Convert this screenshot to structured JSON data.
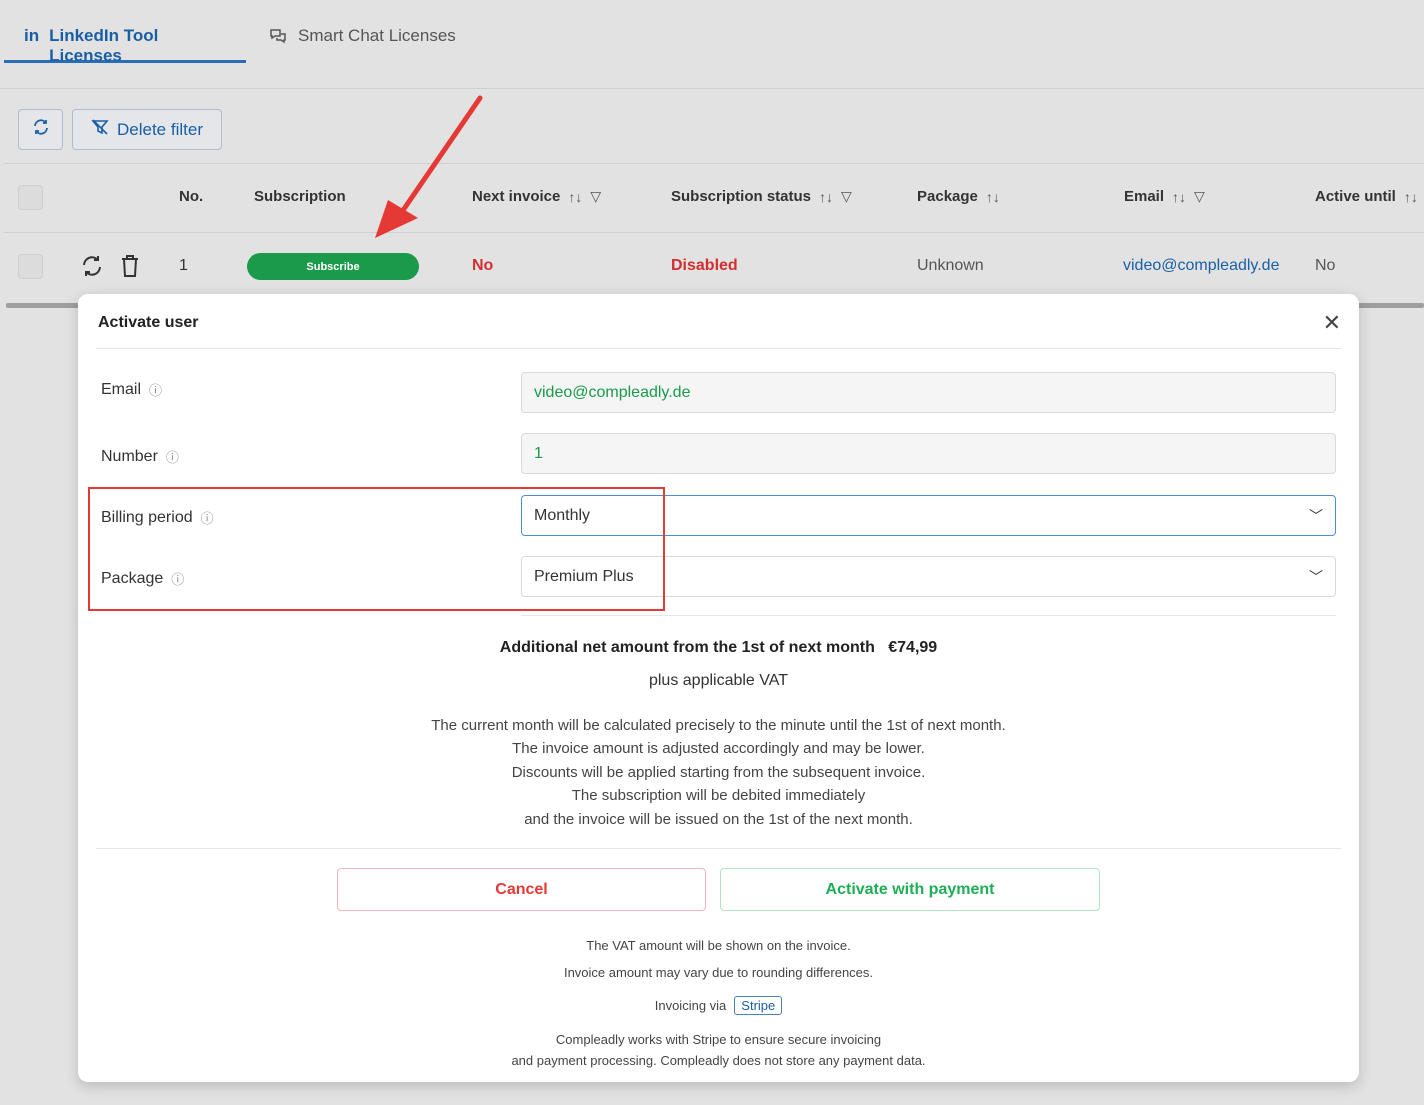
{
  "tabs": [
    {
      "label": "LinkedIn Tool Licenses",
      "icon": "linkedin-icon",
      "active": true
    },
    {
      "label": "Smart Chat Licenses",
      "icon": "chat-icon",
      "active": false
    }
  ],
  "toolbar": {
    "refresh_icon": "refresh-icon",
    "delete_filter_label": "Delete filter"
  },
  "table": {
    "headers": {
      "no": "No.",
      "subscription": "Subscription",
      "next_invoice": "Next invoice",
      "status": "Subscription status",
      "package": "Package",
      "email": "Email",
      "active_until": "Active until"
    },
    "row": {
      "no": "1",
      "subscribe_label": "Subscribe",
      "next_invoice": "No",
      "status": "Disabled",
      "package": "Unknown",
      "email": "video@compleadly.de",
      "active_until": "No"
    }
  },
  "modal": {
    "title": "Activate user",
    "fields": {
      "email_label": "Email",
      "email_value": "video@compleadly.de",
      "number_label": "Number",
      "number_value": "1",
      "billing_label": "Billing period",
      "billing_value": "Monthly",
      "package_label": "Package",
      "package_value": "Premium Plus"
    },
    "amount_text": "Additional net amount from the 1st of next month",
    "amount_value": "€74,99",
    "vat_text": "plus applicable VAT",
    "info_lines": [
      "The current month will be calculated precisely to the minute until the 1st of next month.",
      "The invoice amount is adjusted accordingly and may be lower.",
      "Discounts will be applied starting from the subsequent invoice.",
      "The subscription will be debited immediately",
      "and the invoice will be issued on the 1st of the next month."
    ],
    "cancel_label": "Cancel",
    "activate_label": "Activate with payment",
    "vat_note": "The VAT amount will be shown on the invoice.",
    "rounding_note": "Invoice amount may vary due to rounding differences.",
    "invoicing_via": "Invoicing via",
    "stripe_label": "Stripe",
    "footer_line1": "Compleadly works with Stripe to ensure secure invoicing",
    "footer_line2": "and payment processing. Compleadly does not store any payment data."
  },
  "colors": {
    "primary_blue": "#1a5fa6",
    "success_green": "#1a9a4a",
    "danger_red": "#d32f2f",
    "highlight_red": "#e53935"
  }
}
